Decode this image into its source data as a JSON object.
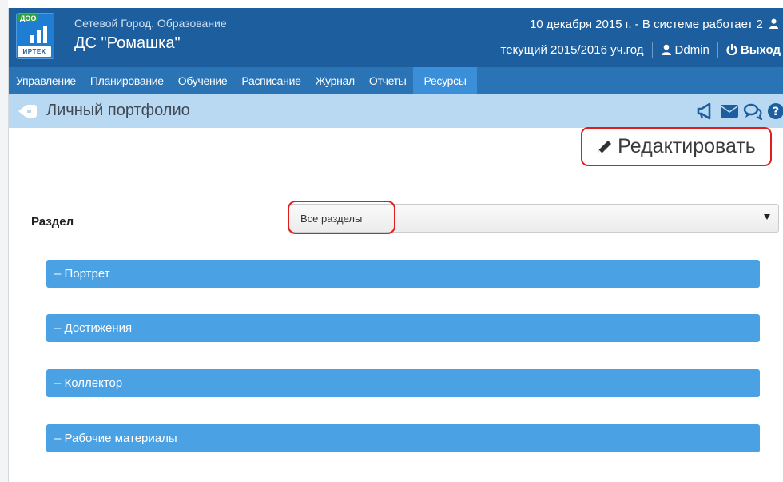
{
  "header": {
    "logo_top": "ДОО",
    "logo_bottom": "ИРТЕХ",
    "org_subtitle": "Сетевой Город. Образование",
    "org_title": "ДС \"Ромашка\"",
    "date_status": "10 декабря 2015 г. - В системе работает 2",
    "school_year": "текущий 2015/2016 уч.год",
    "user": "Ddmin",
    "logout": "Выход",
    "colors": {
      "header_bg": "#1d5f9e",
      "nav_bg": "#2a73b5",
      "nav_active": "#3b8fd8",
      "titlebar_bg": "#b9d8f2"
    }
  },
  "nav": {
    "items": [
      {
        "label": "Управление"
      },
      {
        "label": "Планирование"
      },
      {
        "label": "Обучение"
      },
      {
        "label": "Расписание"
      },
      {
        "label": "Журнал"
      },
      {
        "label": "Отчеты"
      },
      {
        "label": "Ресурсы",
        "active": true
      }
    ]
  },
  "titlebar": {
    "title": "Личный портфолио",
    "icons": [
      "back-arrow-icon",
      "megaphone-icon",
      "envelope-icon",
      "chat-icon",
      "help-icon"
    ]
  },
  "content": {
    "edit_label": "Редактировать",
    "section_label": "Раздел",
    "section_select": {
      "value": "Все разделы"
    },
    "panels": [
      {
        "label": "– Портрет"
      },
      {
        "label": "– Достижения"
      },
      {
        "label": "– Коллектор"
      },
      {
        "label": "– Рабочие материалы"
      }
    ],
    "highlight_color": "#e21d1d",
    "panel_color": "#4aa1e4"
  }
}
